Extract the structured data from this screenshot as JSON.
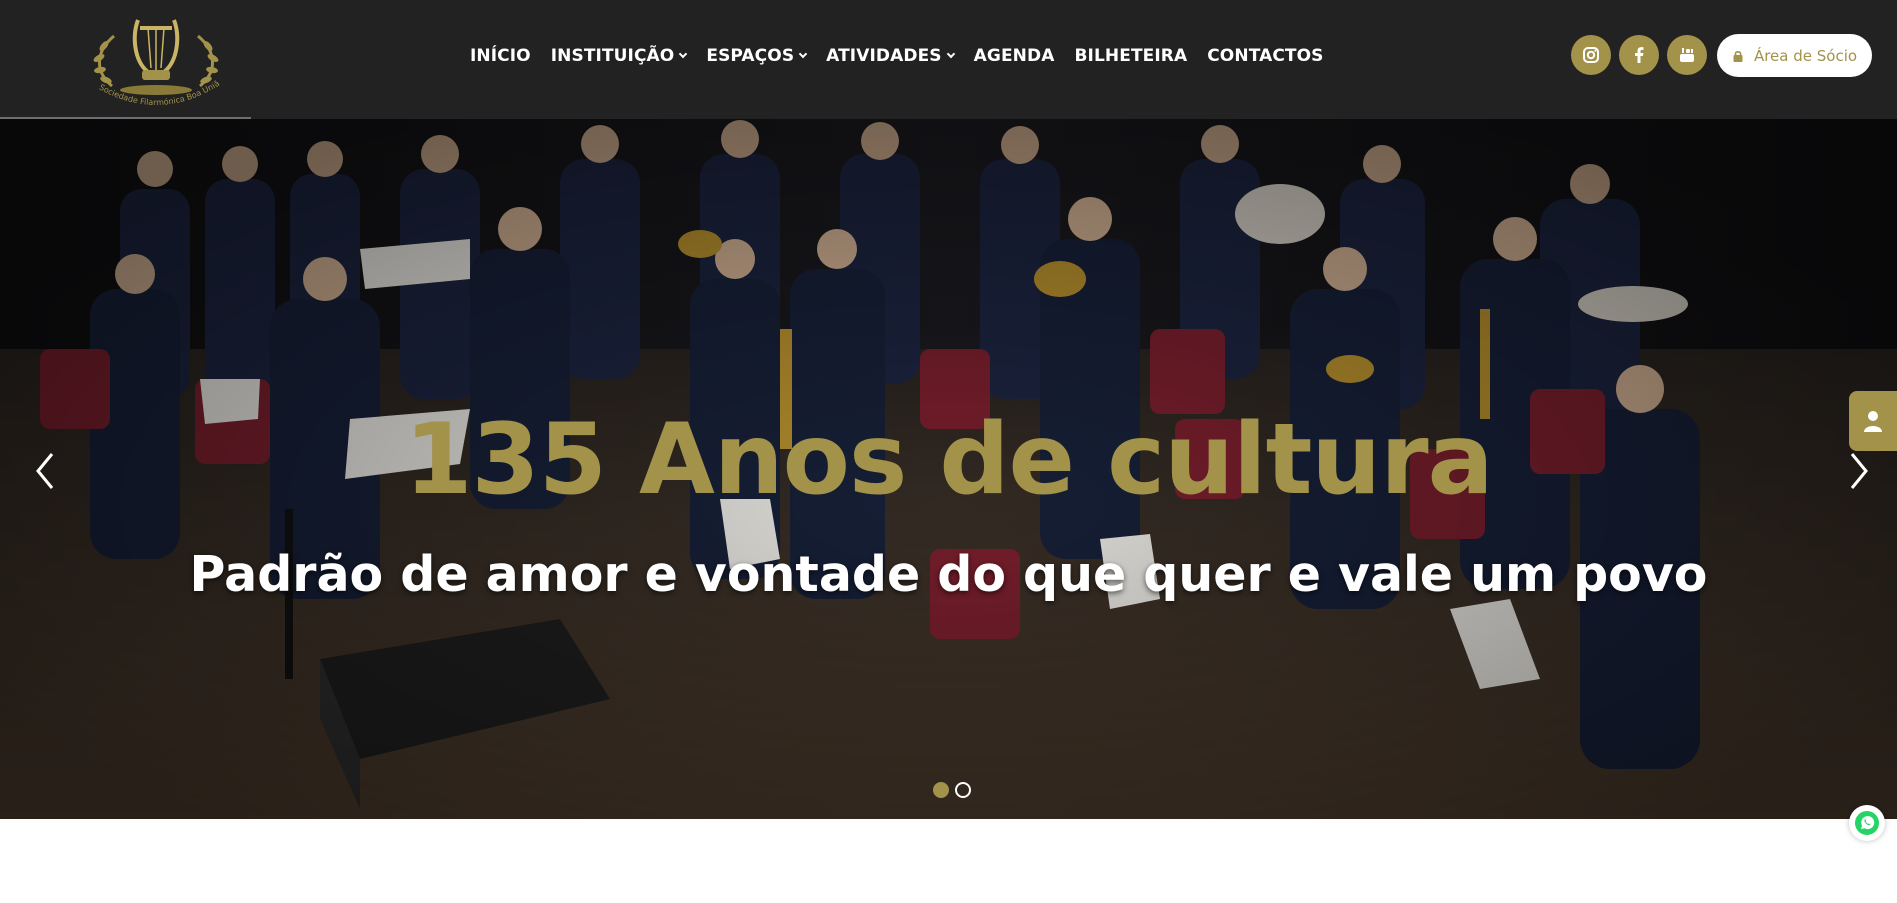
{
  "header": {
    "logo_icon": "lyre-laurel-emblem",
    "logo_text": "Sociedade Filarmónica Boa União Montelavarense",
    "nav": [
      {
        "label": "INÍCIO",
        "has_dropdown": false
      },
      {
        "label": "INSTITUIÇÃO",
        "has_dropdown": true
      },
      {
        "label": "ESPAÇOS",
        "has_dropdown": true
      },
      {
        "label": "ATIVIDADES",
        "has_dropdown": true
      },
      {
        "label": "AGENDA",
        "has_dropdown": false
      },
      {
        "label": "BILHETEIRA",
        "has_dropdown": false
      },
      {
        "label": "CONTACTOS",
        "has_dropdown": false
      }
    ],
    "social": [
      {
        "icon": "instagram-icon"
      },
      {
        "icon": "facebook-icon"
      },
      {
        "icon": "youtube-icon"
      }
    ],
    "member_area": {
      "label": "Área de Sócio",
      "icon": "lock-icon"
    }
  },
  "hero": {
    "title": "135 Anos de cultura",
    "subtitle": "Padrão de amor e vontade do que quer e vale um povo",
    "background": "band-photo",
    "slides": 2,
    "active_slide": 1,
    "prev_icon": "chevron-left-icon",
    "next_icon": "chevron-right-icon"
  },
  "floating": {
    "side_tab_icon": "user-icon",
    "whatsapp_icon": "whatsapp-icon"
  },
  "colors": {
    "header_bg": "#222222",
    "accent": "#a3924a",
    "white": "#ffffff",
    "whatsapp": "#25d366"
  }
}
